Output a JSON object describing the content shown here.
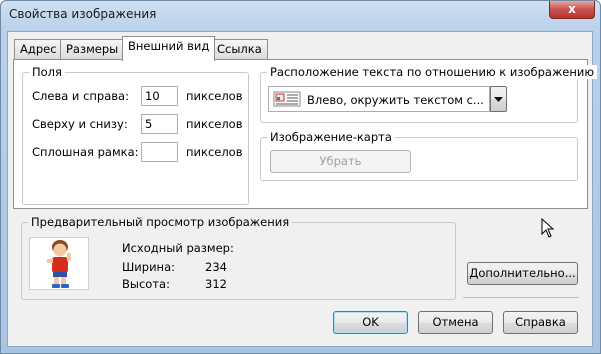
{
  "window": {
    "title": "Свойства изображения",
    "close_glyph": "x"
  },
  "tabs": [
    {
      "label": "Адрес",
      "active": false
    },
    {
      "label": "Размеры",
      "active": false
    },
    {
      "label": "Внешний вид",
      "active": true
    },
    {
      "label": "Ссылка",
      "active": false
    }
  ],
  "spacing": {
    "legend": "Поля",
    "horizontal_label": "Слева и справа:",
    "horizontal_value": "10",
    "vertical_label": "Сверху и снизу:",
    "vertical_value": "5",
    "border_label": "Сплошная рамка:",
    "border_value": "",
    "unit": "пикселов"
  },
  "wrap": {
    "legend": "Расположение текста по отношению к изображению",
    "selected": "Влево, окружить текстом с..."
  },
  "imagemap": {
    "legend": "Изображение-карта",
    "remove_label": "Убрать"
  },
  "preview": {
    "legend": "Предварительный просмотр изображения",
    "original_size_label": "Исходный размер:",
    "width_label": "Ширина:",
    "width_value": "234",
    "height_label": "Высота:",
    "height_value": "312"
  },
  "buttons": {
    "advanced": "Дополнительно...",
    "ok": "OK",
    "cancel": "Отмена",
    "help": "Справка"
  }
}
